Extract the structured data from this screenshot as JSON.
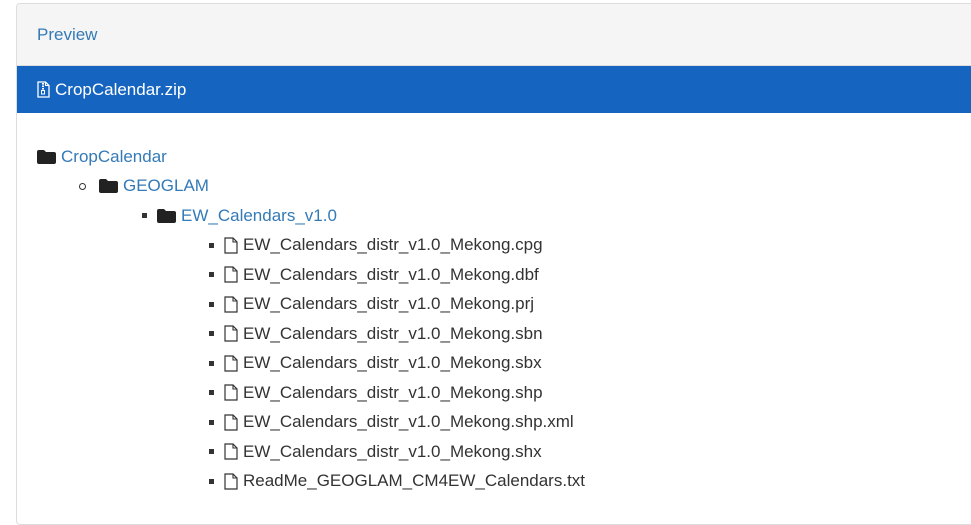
{
  "panel": {
    "title": "Preview"
  },
  "archive": {
    "name": "CropCalendar.zip",
    "icon": "file-zip-icon"
  },
  "tree": {
    "root": {
      "label": "CropCalendar",
      "icon": "folder-icon"
    },
    "level1": {
      "label": "GEOGLAM",
      "icon": "folder-icon"
    },
    "level2": {
      "label": "EW_Calendars_v1.0",
      "icon": "folder-icon"
    },
    "files": [
      "EW_Calendars_distr_v1.0_Mekong.cpg",
      "EW_Calendars_distr_v1.0_Mekong.dbf",
      "EW_Calendars_distr_v1.0_Mekong.prj",
      "EW_Calendars_distr_v1.0_Mekong.sbn",
      "EW_Calendars_distr_v1.0_Mekong.sbx",
      "EW_Calendars_distr_v1.0_Mekong.shp",
      "EW_Calendars_distr_v1.0_Mekong.shp.xml",
      "EW_Calendars_distr_v1.0_Mekong.shx",
      "ReadMe_GEOGLAM_CM4EW_Calendars.txt"
    ]
  },
  "colors": {
    "link": "#337ab7",
    "file_bar": "#1565c0",
    "heading_bg": "#f5f5f5"
  }
}
